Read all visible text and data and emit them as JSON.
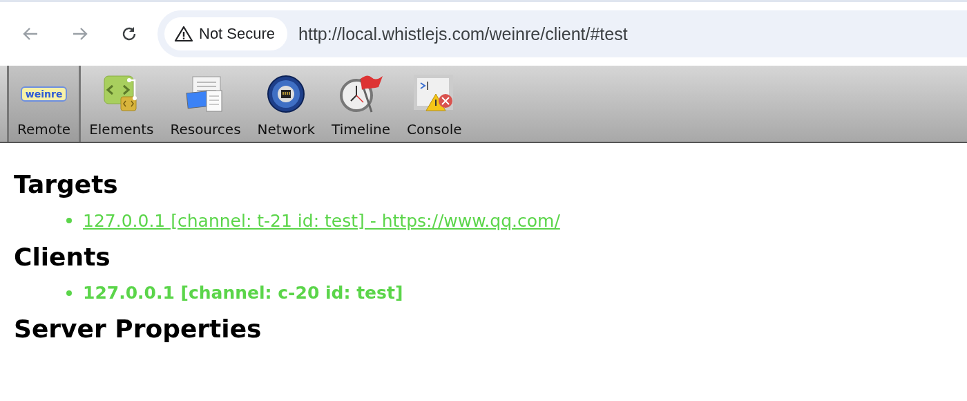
{
  "browser": {
    "security_label": "Not Secure",
    "url": "http://local.whistlejs.com/weinre/client/#test"
  },
  "toolbar": {
    "logo": "weinre",
    "items": [
      {
        "label": "Remote",
        "selected": true
      },
      {
        "label": "Elements",
        "selected": false
      },
      {
        "label": "Resources",
        "selected": false
      },
      {
        "label": "Network",
        "selected": false
      },
      {
        "label": "Timeline",
        "selected": false
      },
      {
        "label": "Console",
        "selected": false
      }
    ]
  },
  "sections": [
    {
      "heading": "Targets",
      "items": [
        {
          "kind": "link",
          "text": "127.0.0.1 [channel: t-21 id: test] - https://www.qq.com/"
        }
      ]
    },
    {
      "heading": "Clients",
      "items": [
        {
          "kind": "text",
          "text": "127.0.0.1 [channel: c-20 id: test]"
        }
      ]
    },
    {
      "heading": "Server Properties"
    }
  ]
}
